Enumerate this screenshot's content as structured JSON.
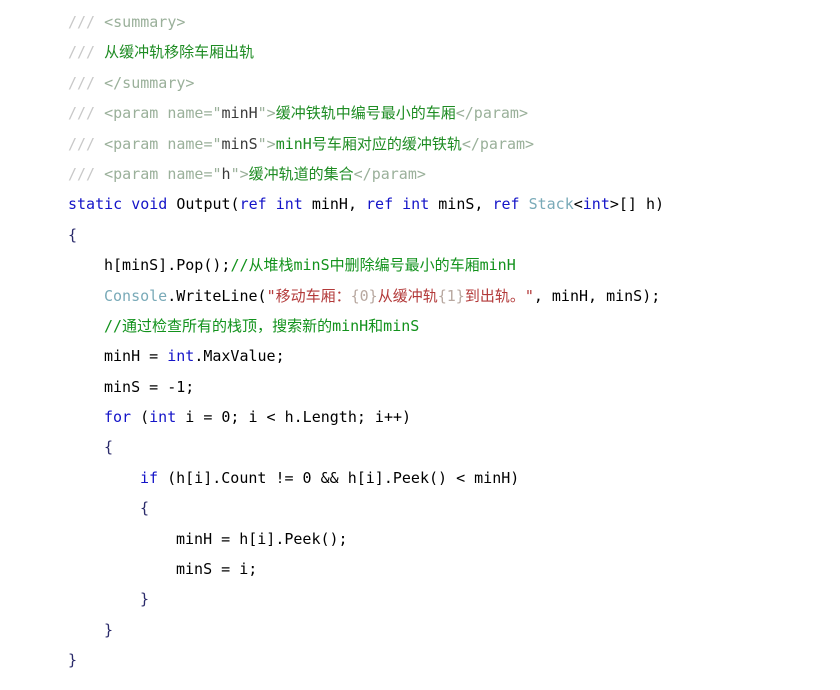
{
  "editor": {
    "language": "C#",
    "background": "#ffffff",
    "font_size_px": 15,
    "line_height_px": 30.4
  },
  "colors": {
    "doc_slash": "#c8c8c8",
    "doc_tag": "#9ab09a",
    "doc_attr_value": "#3b3b3b",
    "doc_text": "#1e8c23",
    "keyword": "#1414c8",
    "type": "#79aab8",
    "plain_text": "#000000",
    "comment": "#12921c",
    "string": "#b33a3a",
    "string_format_placeholder": "#b8a8a0",
    "brace": "#2a2a6a"
  },
  "code": {
    "lines": [
      {
        "indent": 0,
        "tokens": [
          {
            "t": "/// ",
            "c": "docslash"
          },
          {
            "t": "<summary>",
            "c": "doctag"
          }
        ]
      },
      {
        "indent": 0,
        "tokens": [
          {
            "t": "/// ",
            "c": "docslash"
          },
          {
            "t": "从缓冲轨移除车厢出轨",
            "c": "doctext"
          }
        ]
      },
      {
        "indent": 0,
        "tokens": [
          {
            "t": "/// ",
            "c": "docslash"
          },
          {
            "t": "</summary>",
            "c": "doctag"
          }
        ]
      },
      {
        "indent": 0,
        "tokens": [
          {
            "t": "/// ",
            "c": "docslash"
          },
          {
            "t": "<param name=\"",
            "c": "doctag"
          },
          {
            "t": "minH",
            "c": "docattrval"
          },
          {
            "t": "\">",
            "c": "doctag"
          },
          {
            "t": "缓冲铁轨中编号最小的车厢",
            "c": "doctext"
          },
          {
            "t": "</param>",
            "c": "doctag"
          }
        ]
      },
      {
        "indent": 0,
        "tokens": [
          {
            "t": "/// ",
            "c": "docslash"
          },
          {
            "t": "<param name=\"",
            "c": "doctag"
          },
          {
            "t": "minS",
            "c": "docattrval"
          },
          {
            "t": "\">",
            "c": "doctag"
          },
          {
            "t": "minH号车厢对应的缓冲铁轨",
            "c": "doctext"
          },
          {
            "t": "</param>",
            "c": "doctag"
          }
        ]
      },
      {
        "indent": 0,
        "tokens": [
          {
            "t": "/// ",
            "c": "docslash"
          },
          {
            "t": "<param name=\"",
            "c": "doctag"
          },
          {
            "t": "h",
            "c": "docattrval"
          },
          {
            "t": "\">",
            "c": "doctag"
          },
          {
            "t": "缓冲轨道的集合",
            "c": "doctext"
          },
          {
            "t": "</param>",
            "c": "doctag"
          }
        ]
      },
      {
        "indent": 0,
        "tokens": [
          {
            "t": "static",
            "c": "keyword"
          },
          {
            "t": " ",
            "c": "plain"
          },
          {
            "t": "void",
            "c": "keyword"
          },
          {
            "t": " Output(",
            "c": "plain"
          },
          {
            "t": "ref",
            "c": "keyword"
          },
          {
            "t": " ",
            "c": "plain"
          },
          {
            "t": "int",
            "c": "keyword"
          },
          {
            "t": " minH, ",
            "c": "plain"
          },
          {
            "t": "ref",
            "c": "keyword"
          },
          {
            "t": " ",
            "c": "plain"
          },
          {
            "t": "int",
            "c": "keyword"
          },
          {
            "t": " minS, ",
            "c": "plain"
          },
          {
            "t": "ref",
            "c": "keyword"
          },
          {
            "t": " ",
            "c": "plain"
          },
          {
            "t": "Stack",
            "c": "type"
          },
          {
            "t": "<",
            "c": "plain"
          },
          {
            "t": "int",
            "c": "keyword"
          },
          {
            "t": ">[] h)",
            "c": "plain"
          }
        ]
      },
      {
        "indent": 0,
        "tokens": [
          {
            "t": "{",
            "c": "brace"
          }
        ]
      },
      {
        "indent": 1,
        "tokens": [
          {
            "t": "h[minS].Pop();",
            "c": "plain"
          },
          {
            "t": "//从堆栈minS中删除编号最小的车厢minH",
            "c": "comment"
          }
        ]
      },
      {
        "indent": 1,
        "tokens": [
          {
            "t": "Console",
            "c": "type"
          },
          {
            "t": ".WriteLine(",
            "c": "plain"
          },
          {
            "t": "\"移动车厢：",
            "c": "string"
          },
          {
            "t": "{0}",
            "c": "fmt"
          },
          {
            "t": "从缓冲轨",
            "c": "string"
          },
          {
            "t": "{1}",
            "c": "fmt"
          },
          {
            "t": "到出轨。\"",
            "c": "string"
          },
          {
            "t": ", minH, minS);",
            "c": "plain"
          }
        ]
      },
      {
        "indent": 1,
        "tokens": [
          {
            "t": "//通过检查所有的栈顶，搜索新的minH和minS",
            "c": "comment"
          }
        ]
      },
      {
        "indent": 1,
        "tokens": [
          {
            "t": "minH = ",
            "c": "plain"
          },
          {
            "t": "int",
            "c": "keyword"
          },
          {
            "t": ".MaxValue;",
            "c": "plain"
          }
        ]
      },
      {
        "indent": 1,
        "tokens": [
          {
            "t": "minS = -1;",
            "c": "plain"
          }
        ]
      },
      {
        "indent": 1,
        "tokens": [
          {
            "t": "for",
            "c": "keyword"
          },
          {
            "t": " (",
            "c": "plain"
          },
          {
            "t": "int",
            "c": "keyword"
          },
          {
            "t": " i = 0; i < h.Length; i++)",
            "c": "plain"
          }
        ]
      },
      {
        "indent": 1,
        "tokens": [
          {
            "t": "{",
            "c": "brace"
          }
        ]
      },
      {
        "indent": 2,
        "tokens": [
          {
            "t": "if",
            "c": "keyword"
          },
          {
            "t": " (h[i].Count != 0 && h[i].Peek() < minH)",
            "c": "plain"
          }
        ]
      },
      {
        "indent": 2,
        "tokens": [
          {
            "t": "{",
            "c": "brace"
          }
        ]
      },
      {
        "indent": 3,
        "tokens": [
          {
            "t": "minH = h[i].Peek();",
            "c": "plain"
          }
        ]
      },
      {
        "indent": 3,
        "tokens": [
          {
            "t": "minS = i;",
            "c": "plain"
          }
        ]
      },
      {
        "indent": 2,
        "tokens": [
          {
            "t": "}",
            "c": "brace"
          }
        ]
      },
      {
        "indent": 1,
        "tokens": [
          {
            "t": "}",
            "c": "brace"
          }
        ]
      },
      {
        "indent": 0,
        "tokens": [
          {
            "t": "}",
            "c": "brace"
          }
        ]
      }
    ]
  }
}
